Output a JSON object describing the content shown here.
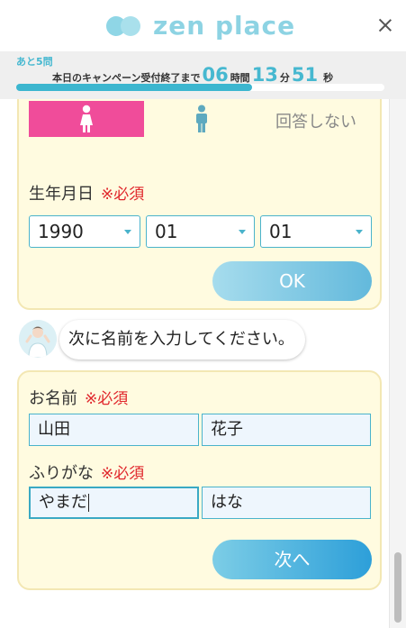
{
  "header": {
    "logo_text": "zen place",
    "close_icon": "close-icon"
  },
  "campaign": {
    "remaining_label": "あと5問",
    "prefix": "本日のキャンペーン受付終了まで",
    "hours": "06",
    "hours_unit": "時間",
    "minutes": "13",
    "minutes_unit": "分",
    "seconds": "51",
    "seconds_unit": "秒",
    "progress_fraction": 0.64,
    "accent_color": "#3cb6cf"
  },
  "gender": {
    "female_icon": "female-icon",
    "male_icon": "male-icon",
    "none_label": "回答しない"
  },
  "birthdate": {
    "label": "生年月日",
    "required": "※必須",
    "year": "1990",
    "month": "01",
    "day": "01",
    "ok_label": "OK"
  },
  "chat": {
    "message": "次に名前を入力してください。"
  },
  "name_form": {
    "name_label": "お名前",
    "name_required": "※必須",
    "last_name": "山田",
    "first_name": "花子",
    "kana_label": "ふりがな",
    "kana_required": "※必須",
    "last_kana": "やまだ",
    "first_kana": "はな",
    "next_label": "次へ"
  },
  "colors": {
    "female_selected": "#f04c9a",
    "required_text": "#e0262b",
    "card_bg": "#fffbe0"
  }
}
